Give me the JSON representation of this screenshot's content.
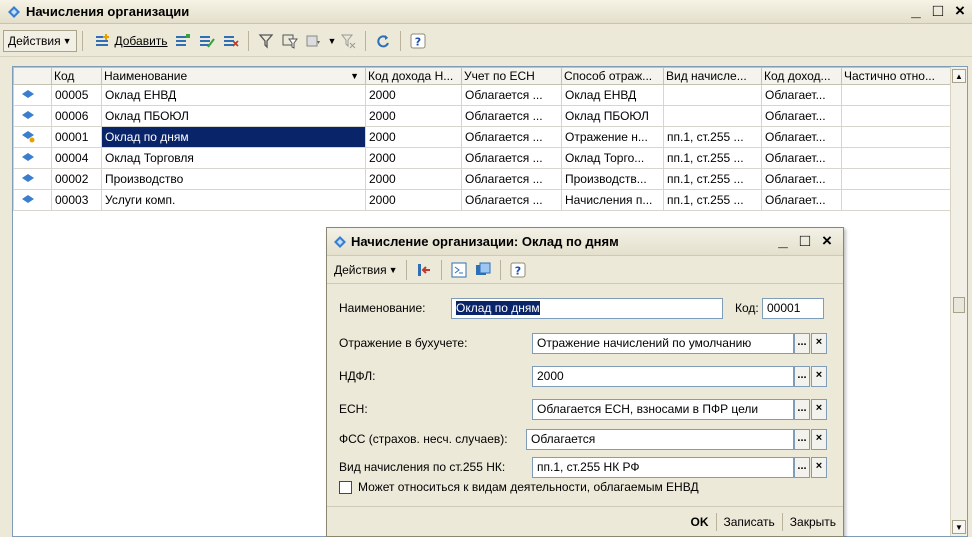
{
  "main": {
    "title": "Начисления организации",
    "toolbar": {
      "actions_label": "Действия",
      "add_label": "Добавить"
    }
  },
  "table": {
    "columns": [
      "Код",
      "Наименование",
      "Код дохода Н...",
      "Учет по ЕСН",
      "Способ отраж...",
      "Вид начисле...",
      "Код доход...",
      "Частично отно..."
    ],
    "rows": [
      {
        "code": "00005",
        "name": "Оклад ЕНВД",
        "income": "2000",
        "esn": "Облагается ...",
        "method": "Оклад ЕНВД",
        "kind": "",
        "code2": "Облагает...",
        "partial": ""
      },
      {
        "code": "00006",
        "name": "Оклад ПБОЮЛ",
        "income": "2000",
        "esn": "Облагается ...",
        "method": "Оклад ПБОЮЛ",
        "kind": "",
        "code2": "Облагает...",
        "partial": ""
      },
      {
        "code": "00001",
        "name": "Оклад по дням",
        "income": "2000",
        "esn": "Облагается ...",
        "method": "Отражение н...",
        "kind": "пп.1, ст.255 ...",
        "code2": "Облагает...",
        "partial": ""
      },
      {
        "code": "00004",
        "name": "Оклад Торговля",
        "income": "2000",
        "esn": "Облагается ...",
        "method": "Оклад Торго...",
        "kind": "пп.1, ст.255 ...",
        "code2": "Облагает...",
        "partial": ""
      },
      {
        "code": "00002",
        "name": "Производство",
        "income": "2000",
        "esn": "Облагается ...",
        "method": "Производств...",
        "kind": "пп.1, ст.255 ...",
        "code2": "Облагает...",
        "partial": ""
      },
      {
        "code": "00003",
        "name": "Услуги комп.",
        "income": "2000",
        "esn": "Облагается ...",
        "method": "Начисления п...",
        "kind": "пп.1, ст.255 ...",
        "code2": "Облагает...",
        "partial": ""
      }
    ]
  },
  "dialog": {
    "title": "Начисление организации: Оклад по дням",
    "actions_label": "Действия",
    "name_label": "Наименование:",
    "name_value": "Оклад по дням",
    "code_label": "Код:",
    "code_value": "00001",
    "accounting_label": "Отражение в бухучете:",
    "accounting_value": "Отражение начислений по умолчанию",
    "ndfl_label": "НДФЛ:",
    "ndfl_value": "2000",
    "esn_label": "ЕСН:",
    "esn_value": "Облагается ЕСН, взносами в ПФР цели",
    "fss_label": "ФСС (страхов. несч. случаев):",
    "fss_value": "Облагается",
    "kind_label": "Вид начисления по ст.255 НК:",
    "kind_value": "пп.1, ст.255 НК РФ",
    "envd_checkbox_label": "Может относиться к видам деятельности, облагаемым  ЕНВД",
    "ok_label": "OK",
    "save_label": "Записать",
    "close_label": "Закрыть"
  },
  "colors": {
    "selection": "#0a246a",
    "accent_blue": "#2f6fb6",
    "window_bg": "#ece9d8"
  }
}
